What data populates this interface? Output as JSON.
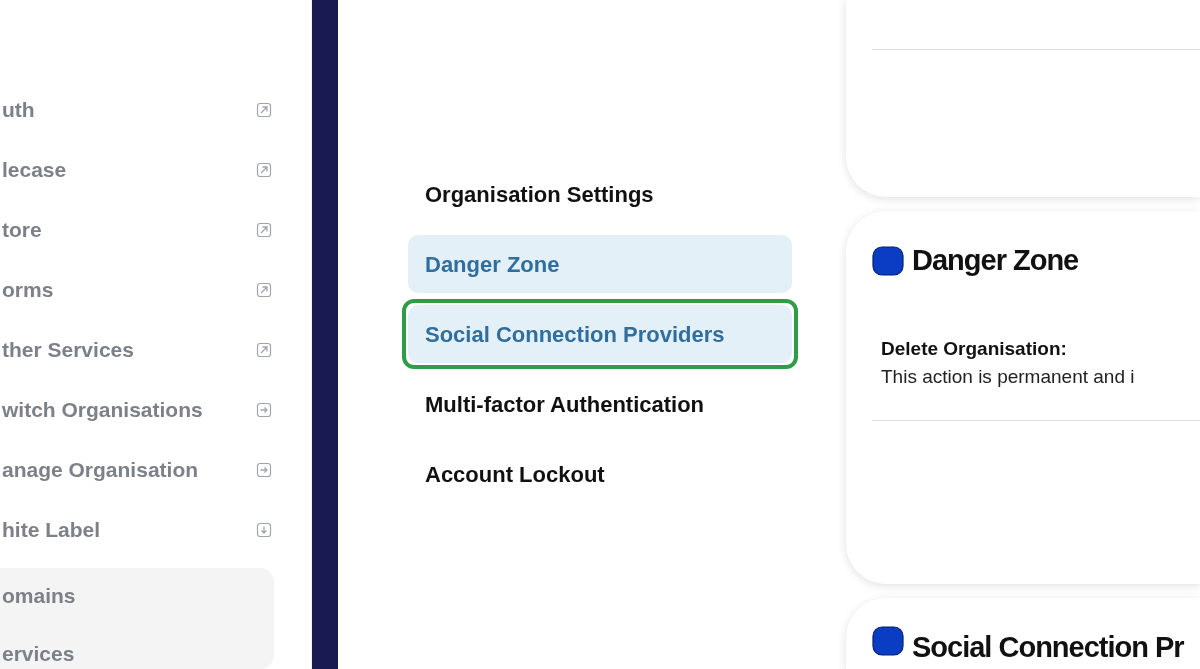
{
  "sidebar": {
    "items": [
      {
        "label": "uth",
        "kind": "external"
      },
      {
        "label": "lecase",
        "kind": "external"
      },
      {
        "label": "tore",
        "kind": "external"
      },
      {
        "label": "orms",
        "kind": "external"
      },
      {
        "label": "ther Services",
        "kind": "external"
      },
      {
        "label": "witch Organisations",
        "kind": "enter"
      },
      {
        "label": "anage Organisation",
        "kind": "enter"
      },
      {
        "label": "hite Label",
        "kind": "expand"
      }
    ],
    "submenu": [
      "omains",
      "ervices"
    ]
  },
  "settings_nav": [
    {
      "label": "Organisation Settings",
      "selected": false,
      "highlighted": false
    },
    {
      "label": "Danger Zone",
      "selected": true,
      "highlighted": false
    },
    {
      "label": "Social Connection Providers",
      "selected": true,
      "highlighted": true
    },
    {
      "label": "Multi-factor Authentication",
      "selected": false,
      "highlighted": false
    },
    {
      "label": "Account Lockout",
      "selected": false,
      "highlighted": false
    }
  ],
  "danger_zone": {
    "title": "Danger Zone",
    "item_title": "Delete Organisation:",
    "item_text": "This action is permanent and i"
  },
  "social_card": {
    "title": "Social Connection Pr"
  }
}
